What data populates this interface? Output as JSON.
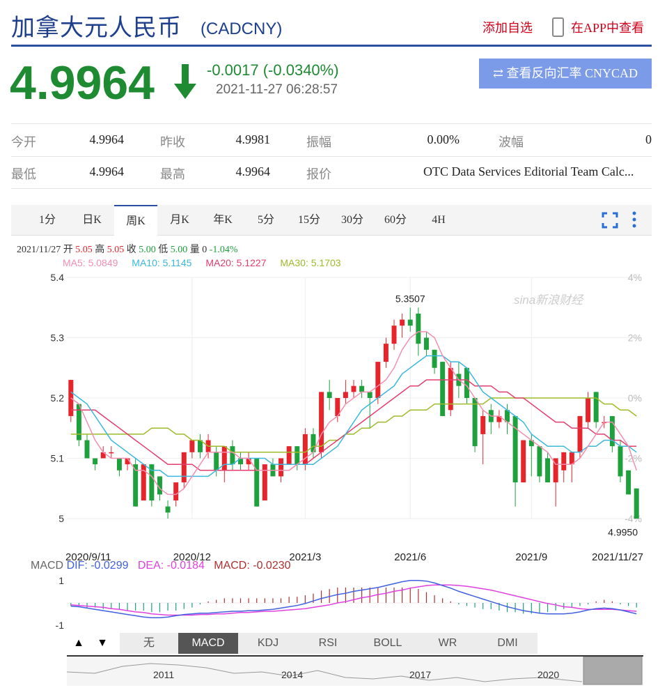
{
  "header": {
    "title": "加拿大元人民币",
    "code": "(CADCNY)",
    "add_favorite": "添加自选",
    "app_view": "在APP中查看"
  },
  "quote": {
    "price": "4.9964",
    "change": "-0.0017 (-0.0340%)",
    "timestamp": "2021-11-27 06:28:57",
    "reverse_button": "⇄ 查看反向汇率 CNYCAD",
    "direction": "down",
    "color": "#1e8a32"
  },
  "stats": {
    "open_label": "今开",
    "open": "4.9964",
    "prev_close_label": "昨收",
    "prev_close": "4.9981",
    "amplitude_label": "振幅",
    "amplitude": "0.00%",
    "volatility_label": "波幅",
    "volatility": "0",
    "low_label": "最低",
    "low": "4.9964",
    "high_label": "最高",
    "high": "4.9964",
    "quote_source_label": "报价",
    "quote_source": "OTC Data Services Editorial Team Calc..."
  },
  "tabs": [
    "1分",
    "日K",
    "周K",
    "月K",
    "年K",
    "5分",
    "15分",
    "30分",
    "60分",
    "4H"
  ],
  "active_tab": "周K",
  "candle_info": {
    "date": "2021/11/27",
    "open_label": "开",
    "open": "5.05",
    "high_label": "高",
    "high": "5.05",
    "close_label": "收",
    "close": "5.00",
    "low_label": "低",
    "low": "5.00",
    "volume_label": "量",
    "volume": "0",
    "change": "-1.04%"
  },
  "ma_legend": {
    "ma5": "MA5: 5.0849",
    "ma10": "MA10: 5.1145",
    "ma20": "MA20: 5.1227",
    "ma30": "MA30: 5.1703"
  },
  "watermark": "sina新浪财经",
  "macd_legend": {
    "label": "MACD",
    "dif": "DIF: -0.0299",
    "dea": "DEA: -0.0184",
    "macd": "MACD: -0.0230"
  },
  "indicator_buttons": [
    "无",
    "MACD",
    "KDJ",
    "RSI",
    "BOLL",
    "WR",
    "DMI"
  ],
  "active_indicator": "MACD",
  "navigator_years": [
    "2011",
    "2014",
    "2017",
    "2020"
  ],
  "colors": {
    "up": "#e8242b",
    "down": "#1ea03c",
    "ma5": "#f28fb0",
    "ma10": "#3ab8dc",
    "ma20": "#e23e6e",
    "ma30": "#9dbb2a",
    "dif": "#4060e0",
    "dea": "#e040e0",
    "accent": "#2a4fa0"
  },
  "chart_data": {
    "type": "candlestick",
    "x_ticks": [
      "2020/9/11",
      "2020/12",
      "2021/3",
      "2021/6",
      "2021/9",
      "2021/11/27"
    ],
    "y_ticks": [
      "5.4",
      "5.3",
      "5.2",
      "5.1",
      "5"
    ],
    "y_right_ticks": [
      "4%",
      "2%",
      "0%",
      "-2%",
      "-4%"
    ],
    "ylim": [
      5.0,
      5.4
    ],
    "max_label": "5.3507",
    "min_label": "4.9950",
    "candles": [
      [
        5.17,
        5.23,
        5.23,
        5.16
      ],
      [
        5.19,
        5.13,
        5.19,
        5.12
      ],
      [
        5.13,
        5.1,
        5.14,
        5.1
      ],
      [
        5.1,
        5.09,
        5.1,
        5.08
      ],
      [
        5.1,
        5.11,
        5.12,
        5.1
      ],
      [
        5.11,
        5.11,
        5.12,
        5.1
      ],
      [
        5.1,
        5.08,
        5.1,
        5.07
      ],
      [
        5.09,
        5.1,
        5.1,
        5.08
      ],
      [
        5.09,
        5.02,
        5.1,
        5.02
      ],
      [
        5.03,
        5.09,
        5.09,
        5.03
      ],
      [
        5.09,
        5.03,
        5.09,
        5.02
      ],
      [
        5.07,
        5.04,
        5.07,
        5.03
      ],
      [
        5.02,
        5.01,
        5.03,
        5.0
      ],
      [
        5.03,
        5.06,
        5.06,
        5.02
      ],
      [
        5.06,
        5.11,
        5.11,
        5.05
      ],
      [
        5.11,
        5.13,
        5.13,
        5.1
      ],
      [
        5.13,
        5.11,
        5.14,
        5.1
      ],
      [
        5.11,
        5.13,
        5.14,
        5.1
      ],
      [
        5.11,
        5.08,
        5.12,
        5.07
      ],
      [
        5.08,
        5.12,
        5.12,
        5.06
      ],
      [
        5.12,
        5.09,
        5.13,
        5.08
      ],
      [
        5.1,
        5.09,
        5.11,
        5.08
      ],
      [
        5.09,
        5.1,
        5.11,
        5.08
      ],
      [
        5.1,
        5.02,
        5.1,
        5.02
      ],
      [
        5.03,
        5.09,
        5.09,
        5.03
      ],
      [
        5.09,
        5.07,
        5.1,
        5.07
      ],
      [
        5.07,
        5.1,
        5.1,
        5.06
      ],
      [
        5.09,
        5.12,
        5.12,
        5.09
      ],
      [
        5.12,
        5.09,
        5.12,
        5.08
      ],
      [
        5.09,
        5.14,
        5.15,
        5.08
      ],
      [
        5.14,
        5.11,
        5.15,
        5.1
      ],
      [
        5.11,
        5.21,
        5.21,
        5.1
      ],
      [
        5.21,
        5.2,
        5.23,
        5.18
      ],
      [
        5.17,
        5.2,
        5.2,
        5.16
      ],
      [
        5.2,
        5.21,
        5.23,
        5.19
      ],
      [
        5.21,
        5.22,
        5.23,
        5.2
      ],
      [
        5.22,
        5.21,
        5.23,
        5.2
      ],
      [
        5.21,
        5.2,
        5.21,
        5.15
      ],
      [
        5.2,
        5.26,
        5.26,
        5.19
      ],
      [
        5.26,
        5.29,
        5.3,
        5.25
      ],
      [
        5.29,
        5.32,
        5.33,
        5.28
      ],
      [
        5.32,
        5.33,
        5.34,
        5.3
      ],
      [
        5.33,
        5.32,
        5.35,
        5.31
      ],
      [
        5.34,
        5.29,
        5.35,
        5.27
      ],
      [
        5.3,
        5.28,
        5.31,
        5.27
      ],
      [
        5.28,
        5.25,
        5.28,
        5.24
      ],
      [
        5.26,
        5.17,
        5.26,
        5.17
      ],
      [
        5.18,
        5.25,
        5.26,
        5.17
      ],
      [
        5.24,
        5.22,
        5.26,
        5.2
      ],
      [
        5.25,
        5.2,
        5.25,
        5.19
      ],
      [
        5.2,
        5.12,
        5.2,
        5.11
      ],
      [
        5.14,
        5.17,
        5.18,
        5.09
      ],
      [
        5.18,
        5.16,
        5.19,
        5.14
      ],
      [
        5.16,
        5.17,
        5.18,
        5.15
      ],
      [
        5.18,
        5.16,
        5.19,
        5.14
      ],
      [
        5.17,
        5.06,
        5.17,
        5.02
      ],
      [
        5.06,
        5.13,
        5.13,
        5.06
      ],
      [
        5.13,
        5.12,
        5.14,
        5.07
      ],
      [
        5.12,
        5.07,
        5.12,
        5.06
      ],
      [
        5.1,
        5.06,
        5.11,
        5.06
      ],
      [
        5.06,
        5.1,
        5.1,
        5.02
      ],
      [
        5.08,
        5.11,
        5.11,
        5.06
      ],
      [
        5.09,
        5.11,
        5.11,
        5.06
      ],
      [
        5.11,
        5.17,
        5.17,
        5.1
      ],
      [
        5.16,
        5.2,
        5.21,
        5.15
      ],
      [
        5.21,
        5.16,
        5.21,
        5.15
      ],
      [
        5.16,
        5.16,
        5.17,
        5.15
      ],
      [
        5.17,
        5.12,
        5.17,
        5.11
      ],
      [
        5.12,
        5.07,
        5.13,
        5.06
      ],
      [
        5.08,
        5.04,
        5.08,
        5.04
      ],
      [
        5.05,
        5.0,
        5.05,
        5.0
      ]
    ],
    "ma5": [
      5.2,
      5.19,
      5.16,
      5.13,
      5.11,
      5.1,
      5.1,
      5.1,
      5.08,
      5.08,
      5.07,
      5.05,
      5.04,
      5.04,
      5.05,
      5.07,
      5.09,
      5.11,
      5.11,
      5.11,
      5.11,
      5.1,
      5.1,
      5.08,
      5.08,
      5.08,
      5.08,
      5.08,
      5.09,
      5.1,
      5.11,
      5.14,
      5.16,
      5.17,
      5.19,
      5.2,
      5.21,
      5.21,
      5.22,
      5.23,
      5.25,
      5.28,
      5.3,
      5.31,
      5.31,
      5.3,
      5.27,
      5.25,
      5.23,
      5.22,
      5.2,
      5.18,
      5.17,
      5.17,
      5.16,
      5.15,
      5.14,
      5.13,
      5.12,
      5.11,
      5.09,
      5.09,
      5.09,
      5.1,
      5.12,
      5.14,
      5.16,
      5.16,
      5.14,
      5.12,
      5.08
    ],
    "ma10": [
      5.21,
      5.2,
      5.19,
      5.17,
      5.15,
      5.13,
      5.12,
      5.11,
      5.1,
      5.09,
      5.08,
      5.08,
      5.07,
      5.07,
      5.07,
      5.07,
      5.07,
      5.07,
      5.08,
      5.09,
      5.09,
      5.1,
      5.1,
      5.1,
      5.1,
      5.09,
      5.09,
      5.09,
      5.09,
      5.09,
      5.09,
      5.1,
      5.11,
      5.12,
      5.14,
      5.16,
      5.18,
      5.19,
      5.2,
      5.21,
      5.22,
      5.24,
      5.25,
      5.26,
      5.27,
      5.27,
      5.27,
      5.26,
      5.26,
      5.25,
      5.23,
      5.21,
      5.2,
      5.19,
      5.18,
      5.17,
      5.16,
      5.14,
      5.13,
      5.12,
      5.12,
      5.12,
      5.11,
      5.11,
      5.12,
      5.12,
      5.13,
      5.13,
      5.12,
      5.12,
      5.11
    ],
    "ma20": [
      5.18,
      5.18,
      5.18,
      5.18,
      5.17,
      5.16,
      5.15,
      5.14,
      5.13,
      5.12,
      5.11,
      5.1,
      5.09,
      5.09,
      5.09,
      5.09,
      5.08,
      5.08,
      5.08,
      5.08,
      5.08,
      5.08,
      5.08,
      5.08,
      5.08,
      5.08,
      5.08,
      5.08,
      5.09,
      5.09,
      5.1,
      5.11,
      5.12,
      5.13,
      5.14,
      5.15,
      5.16,
      5.17,
      5.18,
      5.19,
      5.2,
      5.21,
      5.22,
      5.22,
      5.23,
      5.23,
      5.23,
      5.23,
      5.23,
      5.23,
      5.22,
      5.22,
      5.22,
      5.21,
      5.21,
      5.2,
      5.2,
      5.19,
      5.18,
      5.17,
      5.16,
      5.16,
      5.15,
      5.15,
      5.15,
      5.14,
      5.14,
      5.13,
      5.13,
      5.12,
      5.12
    ],
    "ma30": [
      5.14,
      5.14,
      5.14,
      5.14,
      5.14,
      5.14,
      5.14,
      5.14,
      5.14,
      5.14,
      5.15,
      5.15,
      5.15,
      5.14,
      5.14,
      5.13,
      5.13,
      5.12,
      5.12,
      5.12,
      5.11,
      5.11,
      5.11,
      5.11,
      5.11,
      5.11,
      5.11,
      5.11,
      5.11,
      5.11,
      5.12,
      5.12,
      5.13,
      5.13,
      5.14,
      5.14,
      5.15,
      5.15,
      5.16,
      5.16,
      5.17,
      5.17,
      5.18,
      5.18,
      5.18,
      5.19,
      5.19,
      5.19,
      5.19,
      5.19,
      5.19,
      5.19,
      5.2,
      5.2,
      5.2,
      5.2,
      5.2,
      5.2,
      5.2,
      5.2,
      5.2,
      5.2,
      5.2,
      5.2,
      5.2,
      5.2,
      5.19,
      5.19,
      5.18,
      5.18,
      5.17
    ],
    "macd_hist": [
      -0.02,
      -0.02,
      -0.03,
      -0.03,
      -0.04,
      -0.04,
      -0.04,
      -0.05,
      -0.05,
      -0.05,
      -0.06,
      -0.06,
      -0.05,
      -0.05,
      -0.04,
      -0.03,
      -0.01,
      0.01,
      0.02,
      0.03,
      0.03,
      0.03,
      0.03,
      0.03,
      0.03,
      0.03,
      0.03,
      0.04,
      0.04,
      0.05,
      0.06,
      0.08,
      0.09,
      0.1,
      0.1,
      0.1,
      0.1,
      0.1,
      0.1,
      0.1,
      0.1,
      0.1,
      0.1,
      0.09,
      0.07,
      0.05,
      0.03,
      0.01,
      -0.01,
      -0.02,
      -0.03,
      -0.04,
      -0.04,
      -0.05,
      -0.06,
      -0.06,
      -0.07,
      -0.07,
      -0.07,
      -0.06,
      -0.05,
      -0.04,
      -0.03,
      -0.02,
      -0.01,
      0.01,
      0.02,
      0.01,
      -0.01,
      -0.02,
      -0.03
    ],
    "dif": [
      -0.05,
      -0.06,
      -0.08,
      -0.1,
      -0.12,
      -0.14,
      -0.16,
      -0.18,
      -0.2,
      -0.22,
      -0.23,
      -0.23,
      -0.22,
      -0.2,
      -0.18,
      -0.17,
      -0.16,
      -0.16,
      -0.15,
      -0.14,
      -0.13,
      -0.13,
      -0.12,
      -0.12,
      -0.11,
      -0.1,
      -0.08,
      -0.06,
      -0.04,
      -0.01,
      0.03,
      0.07,
      0.1,
      0.13,
      0.15,
      0.18,
      0.2,
      0.22,
      0.24,
      0.27,
      0.3,
      0.33,
      0.35,
      0.35,
      0.34,
      0.31,
      0.27,
      0.23,
      0.18,
      0.14,
      0.1,
      0.06,
      0.02,
      -0.02,
      -0.06,
      -0.09,
      -0.12,
      -0.14,
      -0.16,
      -0.17,
      -0.17,
      -0.17,
      -0.16,
      -0.14,
      -0.11,
      -0.09,
      -0.08,
      -0.09,
      -0.11,
      -0.14,
      -0.17
    ],
    "dea": [
      -0.03,
      -0.04,
      -0.05,
      -0.06,
      -0.07,
      -0.09,
      -0.1,
      -0.12,
      -0.14,
      -0.15,
      -0.17,
      -0.18,
      -0.19,
      -0.19,
      -0.19,
      -0.19,
      -0.18,
      -0.18,
      -0.17,
      -0.17,
      -0.16,
      -0.15,
      -0.15,
      -0.14,
      -0.13,
      -0.13,
      -0.12,
      -0.11,
      -0.1,
      -0.09,
      -0.07,
      -0.05,
      -0.03,
      0.0,
      0.02,
      0.05,
      0.08,
      0.1,
      0.13,
      0.15,
      0.18,
      0.2,
      0.23,
      0.25,
      0.27,
      0.28,
      0.28,
      0.28,
      0.27,
      0.26,
      0.24,
      0.22,
      0.2,
      0.17,
      0.14,
      0.11,
      0.08,
      0.05,
      0.02,
      -0.01,
      -0.03,
      -0.06,
      -0.07,
      -0.09,
      -0.1,
      -0.1,
      -0.1,
      -0.1,
      -0.11,
      -0.12,
      -0.13
    ],
    "macd_y_ticks": [
      "1",
      "-1"
    ]
  }
}
